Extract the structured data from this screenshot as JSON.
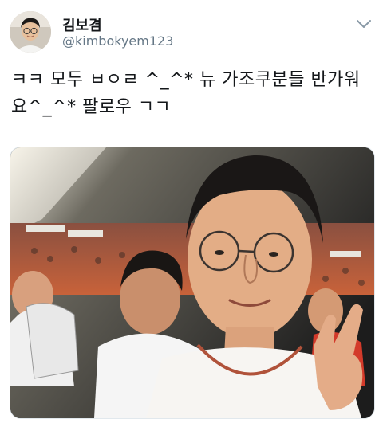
{
  "tweet": {
    "display_name": "김보겸",
    "handle": "@kimbokyem123",
    "text_line1": "ㅋㅋ 모두 ㅂㅇㄹ ^_^* 뉴 가조쿠분들 반가워",
    "text_line2": "요^_^* 팔로우 ㄱㄱ",
    "menu_icon": "chevron-down-icon",
    "avatar_icon": "avatar"
  },
  "colors": {
    "name": "#14171a",
    "handle": "#657786",
    "border": "#e1e8ed"
  }
}
